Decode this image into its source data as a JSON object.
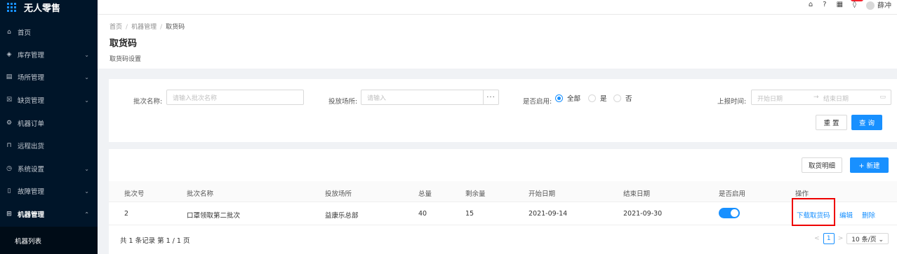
{
  "app": {
    "title": "无人零售"
  },
  "sidebar": {
    "items": [
      {
        "label": "首页",
        "icon": "home-icon",
        "glyph": "⌂",
        "chevron": ""
      },
      {
        "label": "库存管理",
        "icon": "inventory-icon",
        "glyph": "◈",
        "chevron": "⌄"
      },
      {
        "label": "场所管理",
        "icon": "venue-icon",
        "glyph": "▤",
        "chevron": "⌄"
      },
      {
        "label": "缺货管理",
        "icon": "stockout-icon",
        "glyph": "☒",
        "chevron": "⌄"
      },
      {
        "label": "机器订单",
        "icon": "order-icon",
        "glyph": "⚙",
        "chevron": ""
      },
      {
        "label": "远程出货",
        "icon": "remote-ship-icon",
        "glyph": "⊓",
        "chevron": ""
      },
      {
        "label": "系统设置",
        "icon": "settings-icon",
        "glyph": "◷",
        "chevron": "⌄"
      },
      {
        "label": "故障管理",
        "icon": "fault-icon",
        "glyph": "▯",
        "chevron": "⌄"
      },
      {
        "label": "机器管理",
        "icon": "machine-icon",
        "glyph": "⊞",
        "chevron": "⌃"
      }
    ],
    "submenu_label": "机器列表"
  },
  "header": {
    "user_name": "薛冲"
  },
  "breadcrumb": {
    "items": [
      "首页",
      "机器管理",
      "取货码"
    ]
  },
  "page": {
    "title": "取货码",
    "subtitle": "取货码设置"
  },
  "filter": {
    "batch_name_label": "批次名称:",
    "batch_name_placeholder": "请输入批次名称",
    "venue_label": "投放场所:",
    "venue_placeholder": "请输入",
    "enabled_label": "是否启用:",
    "radio_options": [
      "全部",
      "是",
      "否"
    ],
    "selected_option": "全部",
    "report_time_label": "上报时间:",
    "start_placeholder": "开始日期",
    "end_placeholder": "结束日期",
    "range_separator": "→",
    "reset_label": "重 置",
    "query_label": "查 询"
  },
  "table": {
    "detail_button": "取货明细",
    "new_button": "+ 新建",
    "columns": [
      "批次号",
      "批次名称",
      "投放场所",
      "总量",
      "剩余量",
      "开始日期",
      "结束日期",
      "是否启用",
      "操作"
    ],
    "rows": [
      {
        "batch_no": "2",
        "batch_name": "口罩领取第二批次",
        "venue": "益康乐总部",
        "total": "40",
        "remaining": "15",
        "start_date": "2021-09-14",
        "end_date": "2021-09-30",
        "enabled": true,
        "actions": [
          "下载取货码",
          "编辑",
          "删除"
        ]
      }
    ],
    "footer_text": "共 1 条记录 第 1 / 1 页",
    "pager": {
      "prev": "<",
      "current": "1",
      "next": ">",
      "page_size": "10 条/页 ⌄"
    }
  },
  "colors": {
    "primary": "#1890ff",
    "sidebar_bg": "#001529",
    "highlight_box": "#e00000"
  }
}
